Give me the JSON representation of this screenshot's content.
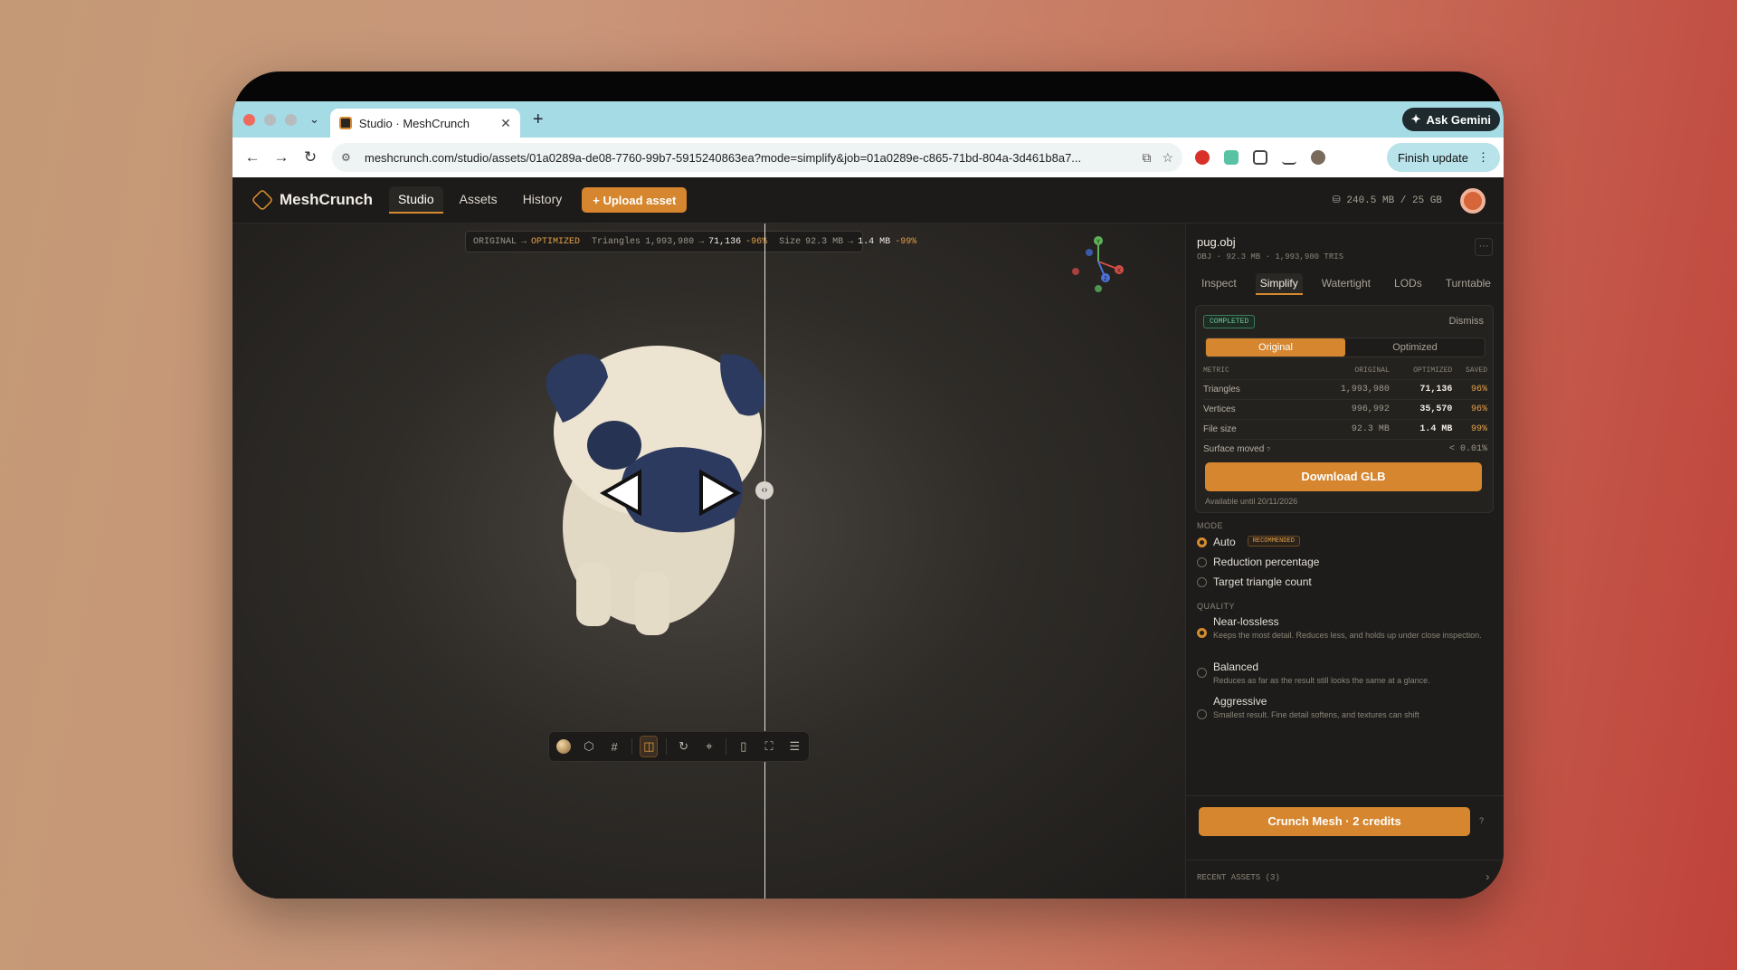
{
  "browser": {
    "tab_title": "Studio · MeshCrunch",
    "tab_close": "✕",
    "new_tab": "+",
    "tab_dropdown": "⌄",
    "ask_gemini": "Ask Gemini",
    "url": "meshcrunch.com/studio/assets/01a0289a-de08-7760-99b7-5915240863ea?mode=simplify&job=01a0289e-c865-71bd-804a-3d461b8a7...",
    "finish_update": "Finish update",
    "traffic_colors": [
      "#ee6a5f",
      "#b6bcbe",
      "#b6bcbe"
    ]
  },
  "app": {
    "brand": "MeshCrunch",
    "nav": [
      "Studio",
      "Assets",
      "History"
    ],
    "upload_label": "+ Upload asset",
    "storage": "240.5 MB / 25 GB",
    "accent": "#d6862e"
  },
  "viewport": {
    "original_label": "ORIGINAL",
    "arrow": "→",
    "optimized_label": "OPTIMIZED",
    "triangles_label": "Triangles",
    "triangles_original": "1,993,980",
    "triangles_optimized": "71,136",
    "triangles_delta": "-96%",
    "size_label": "Size",
    "size_original": "92.3 MB",
    "size_optimized": "1.4 MB",
    "size_delta": "-99%",
    "gizmo_axes": [
      "Y",
      "X",
      "Z"
    ],
    "toolbar_icons": [
      "material-sphere-icon",
      "cube-icon",
      "grid-icon",
      "split-compare-icon",
      "rotate-icon",
      "focus-icon",
      "side-panel-icon",
      "fullscreen-icon",
      "sliders-icon"
    ]
  },
  "panel": {
    "file_name": "pug.obj",
    "file_meta": "OBJ · 92.3 MB · 1,993,980 TRIS",
    "more": "···",
    "tabs": [
      "Inspect",
      "Simplify",
      "Watertight",
      "LODs",
      "Turntable"
    ],
    "status": "COMPLETED",
    "dismiss": "Dismiss",
    "segment": [
      "Original",
      "Optimized"
    ],
    "table_headers": [
      "METRIC",
      "ORIGINAL",
      "OPTIMIZED",
      "SAVED"
    ],
    "rows": [
      {
        "metric": "Triangles",
        "original": "1,993,980",
        "optimized": "71,136",
        "saved": "96%"
      },
      {
        "metric": "Vertices",
        "original": "996,992",
        "optimized": "35,570",
        "saved": "96%"
      },
      {
        "metric": "File size",
        "original": "92.3 MB",
        "optimized": "1.4 MB",
        "saved": "99%"
      }
    ],
    "surface_label": "Surface moved",
    "surface_help": "?",
    "surface_value": "< 0.01%",
    "download": "Download GLB",
    "available": "Available until 20/11/2026",
    "mode_title": "MODE",
    "modes": [
      "Auto",
      "Reduction percentage",
      "Target triangle count"
    ],
    "recommended": "RECOMMENDED",
    "quality_title": "QUALITY",
    "qualities": [
      {
        "name": "Near-lossless",
        "desc": "Keeps the most detail. Reduces less, and holds up under close inspection."
      },
      {
        "name": "Balanced",
        "desc": "Reduces as far as the result still looks the same at a glance."
      },
      {
        "name": "Aggressive",
        "desc": "Smallest result. Fine detail softens, and textures can shift"
      }
    ],
    "crunch": "Crunch Mesh · 2 credits",
    "crunch_help": "?",
    "recent": "RECENT ASSETS (3)",
    "recent_chev": "›"
  }
}
